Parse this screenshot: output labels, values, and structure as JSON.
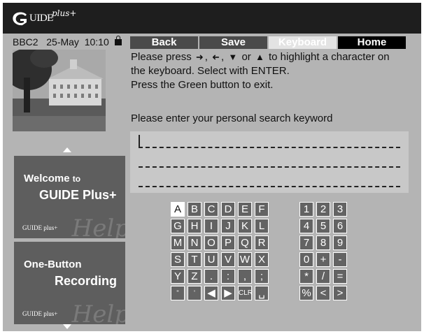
{
  "header": {
    "logo_main": "UIDE",
    "logo_plus": "plus+"
  },
  "status": {
    "channel": "BBC2",
    "date": "25-May",
    "time": "10:10"
  },
  "tabs": [
    {
      "label": "Back"
    },
    {
      "label": "Save"
    },
    {
      "label": "Keyboard"
    },
    {
      "label": "Home"
    }
  ],
  "instructions": {
    "line1_a": "Please press",
    "line1_b": ",",
    "line1_c": ",",
    "line1_d": "or",
    "line1_e": "to highlight a character on",
    "line2": "the keyboard. Select with ENTER.",
    "line3": "Press the Green button to exit."
  },
  "prompt": "Please enter your personal search keyword",
  "input": {
    "value": ""
  },
  "promos": [
    {
      "line1": "Welcome",
      "line1_small": "to",
      "line2": "GUIDE Plus+",
      "watermark": "Help",
      "logo": "GUIDE plus+"
    },
    {
      "line1": "One-Button",
      "line2": "Recording",
      "watermark": "Help",
      "logo": "GUIDE plus+"
    }
  ],
  "keyboard": {
    "letters": [
      [
        "A",
        "B",
        "C",
        "D",
        "E",
        "F"
      ],
      [
        "G",
        "H",
        "I",
        "J",
        "K",
        "L"
      ],
      [
        "M",
        "N",
        "O",
        "P",
        "Q",
        "R"
      ],
      [
        "S",
        "T",
        "U",
        "V",
        "W",
        "X"
      ],
      [
        "Y",
        "Z",
        ".",
        ":",
        ",",
        ";"
      ],
      [
        "\"",
        "'",
        "◀",
        "▶",
        "CLR",
        "␣"
      ]
    ],
    "numbers": [
      [
        "1",
        "2",
        "3"
      ],
      [
        "4",
        "5",
        "6"
      ],
      [
        "7",
        "8",
        "9"
      ],
      [
        "0",
        "+",
        "-"
      ],
      [
        "*",
        "/",
        "="
      ],
      [
        "%",
        "<",
        ">"
      ]
    ],
    "selected": "A"
  },
  "colors": {
    "background": "#b4b4b4",
    "header": "#1e1e1e",
    "key": "#636363",
    "tab": "#4a4a4a"
  },
  "icons": {
    "lock": "lock-icon",
    "arrows": [
      "arrow-right-icon",
      "arrow-left-icon",
      "arrow-down-icon",
      "arrow-up-icon"
    ]
  }
}
